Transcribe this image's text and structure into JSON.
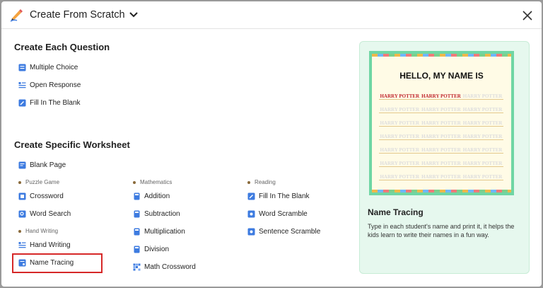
{
  "header": {
    "title": "Create From Scratch"
  },
  "create_each": {
    "title": "Create Each Question",
    "items": [
      "Multiple Choice",
      "Open Response",
      "Fill In The Blank"
    ]
  },
  "create_specific": {
    "title": "Create Specific Worksheet",
    "blank": "Blank Page",
    "categories": {
      "puzzle": "Puzzle Game",
      "handwriting": "Hand Writing",
      "math": "Mathematics",
      "reading": "Reading"
    },
    "puzzle_items": [
      "Crossword",
      "Word Search"
    ],
    "handwriting_items": [
      "Hand Writing",
      "Name Tracing"
    ],
    "math_items": [
      "Addition",
      "Subtraction",
      "Multiplication",
      "Division",
      "Math Crossword"
    ],
    "reading_items": [
      "Fill In The Blank",
      "Word Scramble",
      "Sentence Scramble"
    ]
  },
  "preview": {
    "sheet_title": "HELLO, MY NAME IS",
    "trace_name": "HARRY POTTER",
    "title": "Name Tracing",
    "description": "Type in each student's name and print it, it helps the kids learn to write their names in a fun way."
  },
  "colors": {
    "accent": "#3d7be0",
    "selected_border": "#d62828",
    "preview_bg": "#e6f8ee",
    "sheet_border": "#6fd6a4"
  }
}
